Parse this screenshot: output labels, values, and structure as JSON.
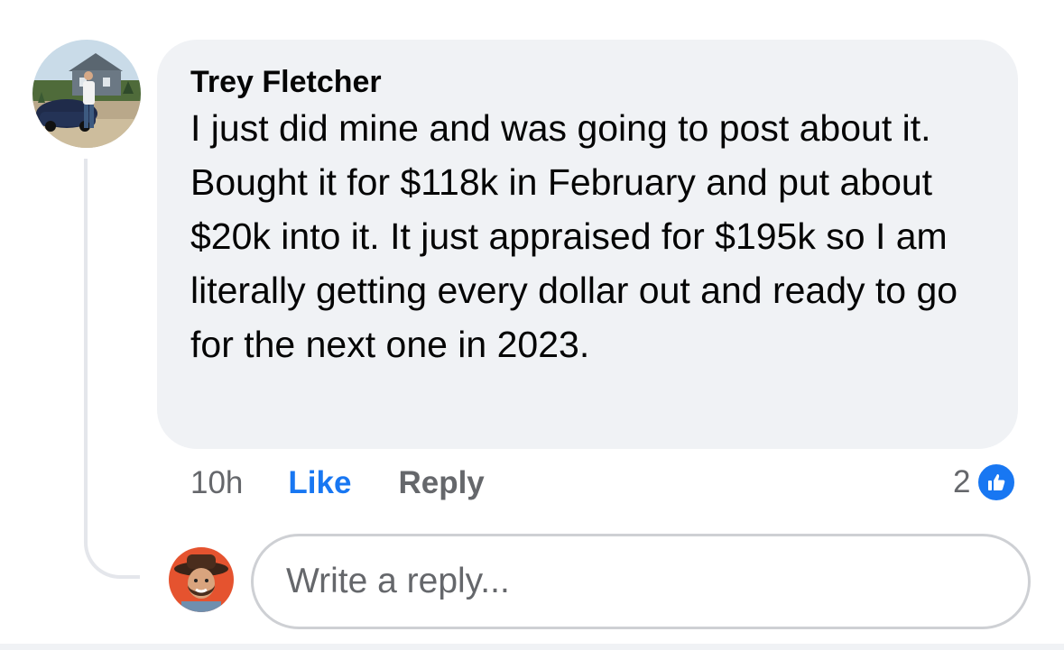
{
  "comment": {
    "author": "Trey Fletcher",
    "text": "I just did mine and was going to post about it. Bought it for $118k in February and put about $20k into it. It just appraised for $195k so I am literally getting every dollar out and ready to go for the next one in 2023.",
    "timestamp": "10h",
    "like_label": "Like",
    "reply_label": "Reply",
    "reaction_count": "2"
  },
  "reply_box": {
    "placeholder": "Write a reply..."
  },
  "colors": {
    "accent": "#1877f2",
    "bubble_bg": "#f0f2f5",
    "secondary_text": "#65676b"
  },
  "icons": {
    "reaction": "thumbs-up-icon"
  }
}
